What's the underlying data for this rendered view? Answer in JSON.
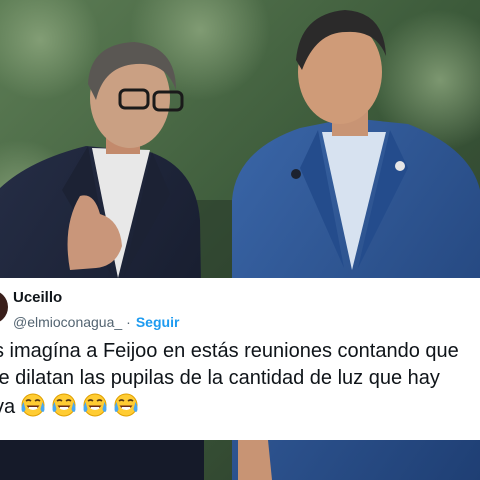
{
  "tweet": {
    "name": "Uceillo",
    "handle": "@elmioconagua_",
    "separator": "·",
    "follow_label": "Seguir",
    "text_lines": [
      "s imagína a Feijoo en estás reuniones contando que",
      "le dilatan las pupilas de la cantidad de luz que hay",
      "va"
    ],
    "emoji_count": 4,
    "emoji_name": "face-with-tears-of-joy"
  },
  "photo": {
    "subject_left": "man with glasses in dark suit",
    "subject_right": "man in blue suit with lapel pin",
    "colors": {
      "left_suit": "#1b2238",
      "right_suit": "#2c4f8c",
      "foliage": "#4a6a44"
    }
  }
}
